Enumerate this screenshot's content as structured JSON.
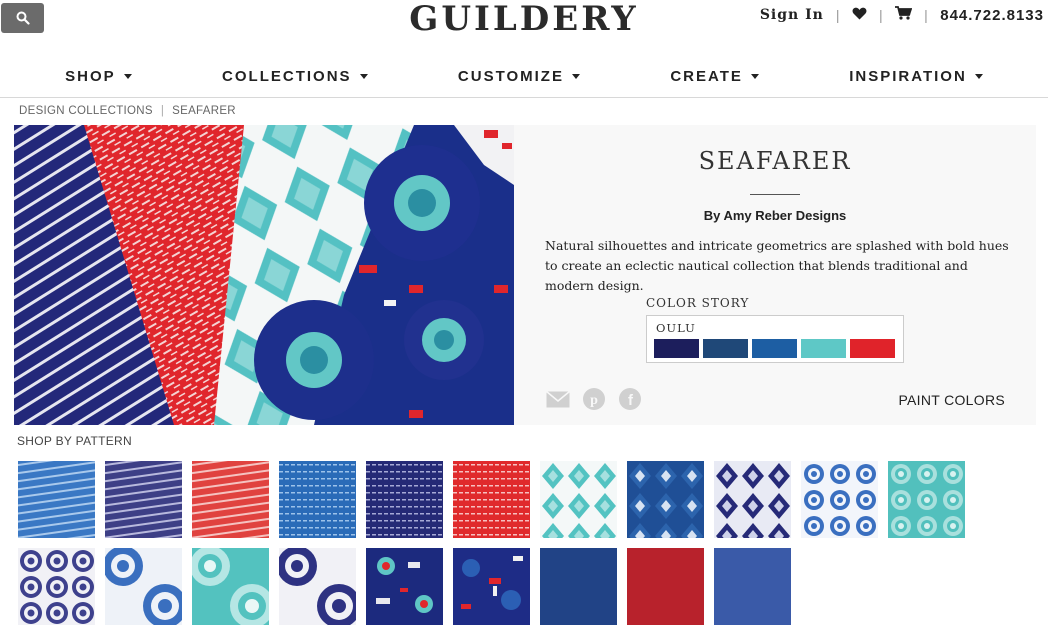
{
  "header": {
    "search_icon": "search-icon",
    "logo": "GUILDERY",
    "sign_in": "Sign In",
    "heart_icon": "heart-icon",
    "cart_icon": "cart-icon",
    "phone": "844.722.8133"
  },
  "nav": {
    "items": [
      {
        "label": "SHOP"
      },
      {
        "label": "COLLECTIONS"
      },
      {
        "label": "CUSTOMIZE"
      },
      {
        "label": "CREATE"
      },
      {
        "label": "INSPIRATION"
      }
    ]
  },
  "breadcrumb": {
    "items": [
      "DESIGN COLLECTIONS",
      "SEAFARER"
    ],
    "separator": "|"
  },
  "collection": {
    "title": "SEAFARER",
    "by": "By Amy Reber Designs",
    "description": "Natural silhouettes and intricate geometrics are splashed with bold hues to create an eclectic nautical collection that blends traditional and modern design.",
    "color_story_label": "COLOR STORY",
    "palette_name": "OULU",
    "palette": [
      "#1c1e5c",
      "#1f4878",
      "#1d5ea3",
      "#5ec8c6",
      "#e0232a"
    ],
    "share_icons": [
      "email-icon",
      "pinterest-icon",
      "facebook-icon"
    ],
    "paint_colors": "PAINT COLORS"
  },
  "shop_by_pattern": {
    "label": "SHOP BY PATTERN"
  },
  "colors": {
    "navy": "#1c1e5c",
    "royal": "#1d5ea3",
    "turquoise": "#5ec8c6",
    "red": "#e0232a",
    "gray": "#6b6b6b"
  }
}
